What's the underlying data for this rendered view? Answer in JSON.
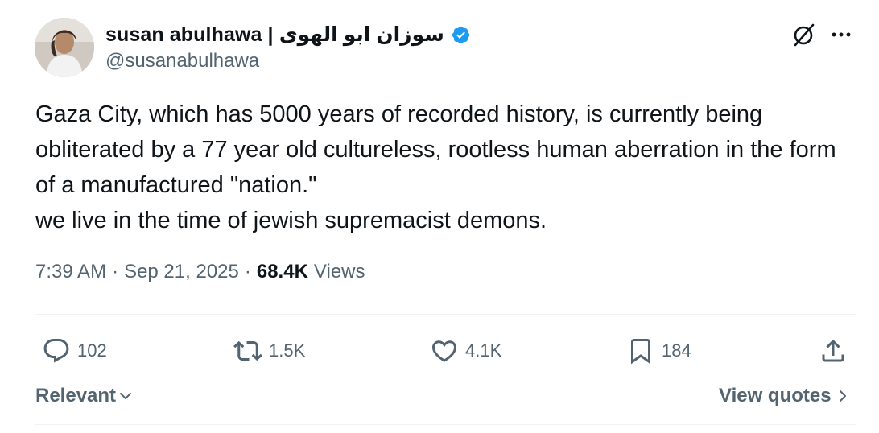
{
  "author": {
    "display_name": "susan abulhawa | سوزان ابو الهوى",
    "handle": "@susanabulhawa",
    "verified": true,
    "verified_color": "#1d9bf0"
  },
  "tweet": {
    "text": "Gaza City, which has 5000 years of recorded history, is currently being obliterated by a 77 year old cultureless, rootless human aberration in the form of a manufactured \"nation.\"\nwe live in the time of jewish supremacist demons.",
    "time": "7:39 AM",
    "date": "Sep 21, 2025",
    "separator": "·",
    "views_count": "68.4K",
    "views_label": "Views"
  },
  "actions": {
    "reply_count": "102",
    "repost_count": "1.5K",
    "like_count": "4.1K",
    "bookmark_count": "184"
  },
  "footer": {
    "sort_label": "Relevant",
    "quotes_label": "View quotes"
  },
  "icons": [
    "grok-icon",
    "more-icon",
    "reply-icon",
    "repost-icon",
    "like-icon",
    "bookmark-icon",
    "share-icon",
    "chevron-down-icon",
    "chevron-right-icon"
  ],
  "colors": {
    "text": "#0f1419",
    "secondary": "#536471",
    "divider": "#eff3f4"
  }
}
